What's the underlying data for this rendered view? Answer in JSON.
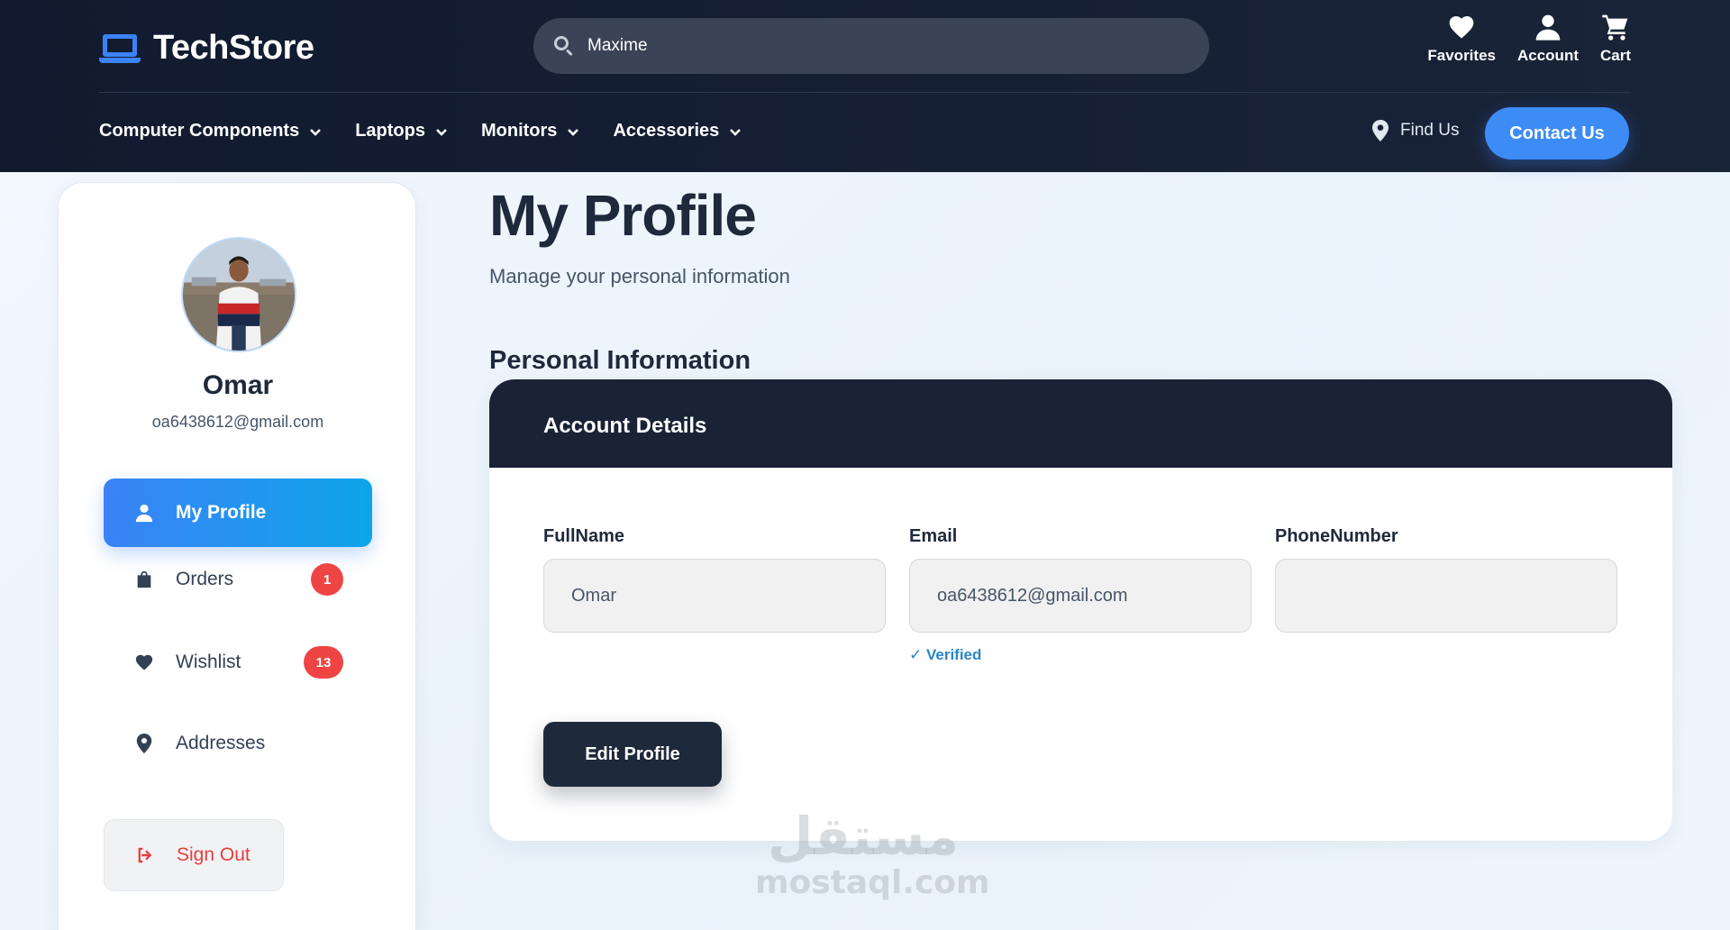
{
  "brand": {
    "name": "TechStore",
    "accent": "#3b82f6"
  },
  "search": {
    "value": "Maxime",
    "placeholder": "Maxime"
  },
  "top_actions": [
    {
      "label": "Favorites",
      "icon": "heart-icon"
    },
    {
      "label": "Account",
      "icon": "user-icon"
    },
    {
      "label": "Cart",
      "icon": "cart-icon"
    }
  ],
  "nav": {
    "items": [
      {
        "label": "Computer Components"
      },
      {
        "label": "Laptops"
      },
      {
        "label": "Monitors"
      },
      {
        "label": "Accessories"
      }
    ],
    "find_us": "Find Us",
    "contact": "Contact Us"
  },
  "user": {
    "name": "Omar",
    "email": "oa6438612@gmail.com"
  },
  "sidebar": {
    "items": [
      {
        "label": "My Profile",
        "icon": "user-icon",
        "active": true
      },
      {
        "label": "Orders",
        "icon": "shopping-bag-icon",
        "badge": "1"
      },
      {
        "label": "Wishlist",
        "icon": "heart-icon",
        "badge": "13"
      },
      {
        "label": "Addresses",
        "icon": "map-pin-icon"
      }
    ],
    "sign_out": "Sign Out"
  },
  "main": {
    "title": "My Profile",
    "subtitle": "Manage your personal information",
    "section_title": "Personal Information",
    "card_title": "Account Details",
    "fields": [
      {
        "label": "FullName",
        "value": "Omar"
      },
      {
        "label": "Email",
        "value": "oa6438612@gmail.com"
      },
      {
        "label": "PhoneNumber",
        "value": ""
      }
    ],
    "verified": "✓ Verified",
    "edit_button": "Edit Profile"
  },
  "watermark": {
    "arabic": "مستقل",
    "latin": "mostaql.com"
  },
  "colors": {
    "header_bg": "#111a2e",
    "badge": "#ef4444",
    "danger": "#e53e3e",
    "verified": "#2b86c5"
  }
}
